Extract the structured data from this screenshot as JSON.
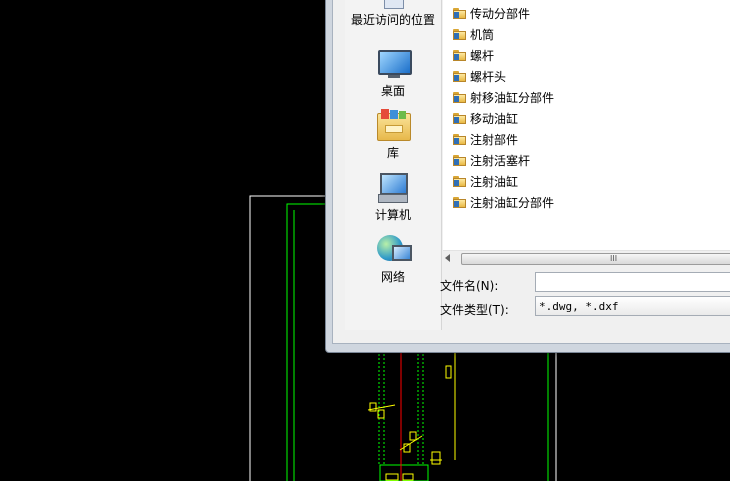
{
  "places": [
    {
      "label": "最近访问的位置",
      "icon": "recent-places-icon"
    },
    {
      "label": "桌面",
      "icon": "desktop-icon"
    },
    {
      "label": "库",
      "icon": "libraries-icon"
    },
    {
      "label": "计算机",
      "icon": "computer-icon"
    },
    {
      "label": "网络",
      "icon": "network-icon"
    }
  ],
  "files": [
    "传动分部件",
    "机筒",
    "螺杆",
    "螺杆头",
    "射移油缸分部件",
    "移动油缸",
    "注射部件",
    "注射活塞杆",
    "注射油缸",
    "注射油缸分部件"
  ],
  "scrollbar": {
    "grip": "III"
  },
  "form": {
    "filename_label": "文件名(N):",
    "filename_value": "",
    "filetype_label": "文件类型(T):",
    "filetype_value": "*.dwg, *.dxf"
  },
  "colors": {
    "cad_background": "#000000",
    "cad_white": "#ffffff",
    "cad_green": "#00ff00",
    "cad_yellow": "#ffff00",
    "cad_red": "#ff0000",
    "folder": "#f5d56a"
  }
}
